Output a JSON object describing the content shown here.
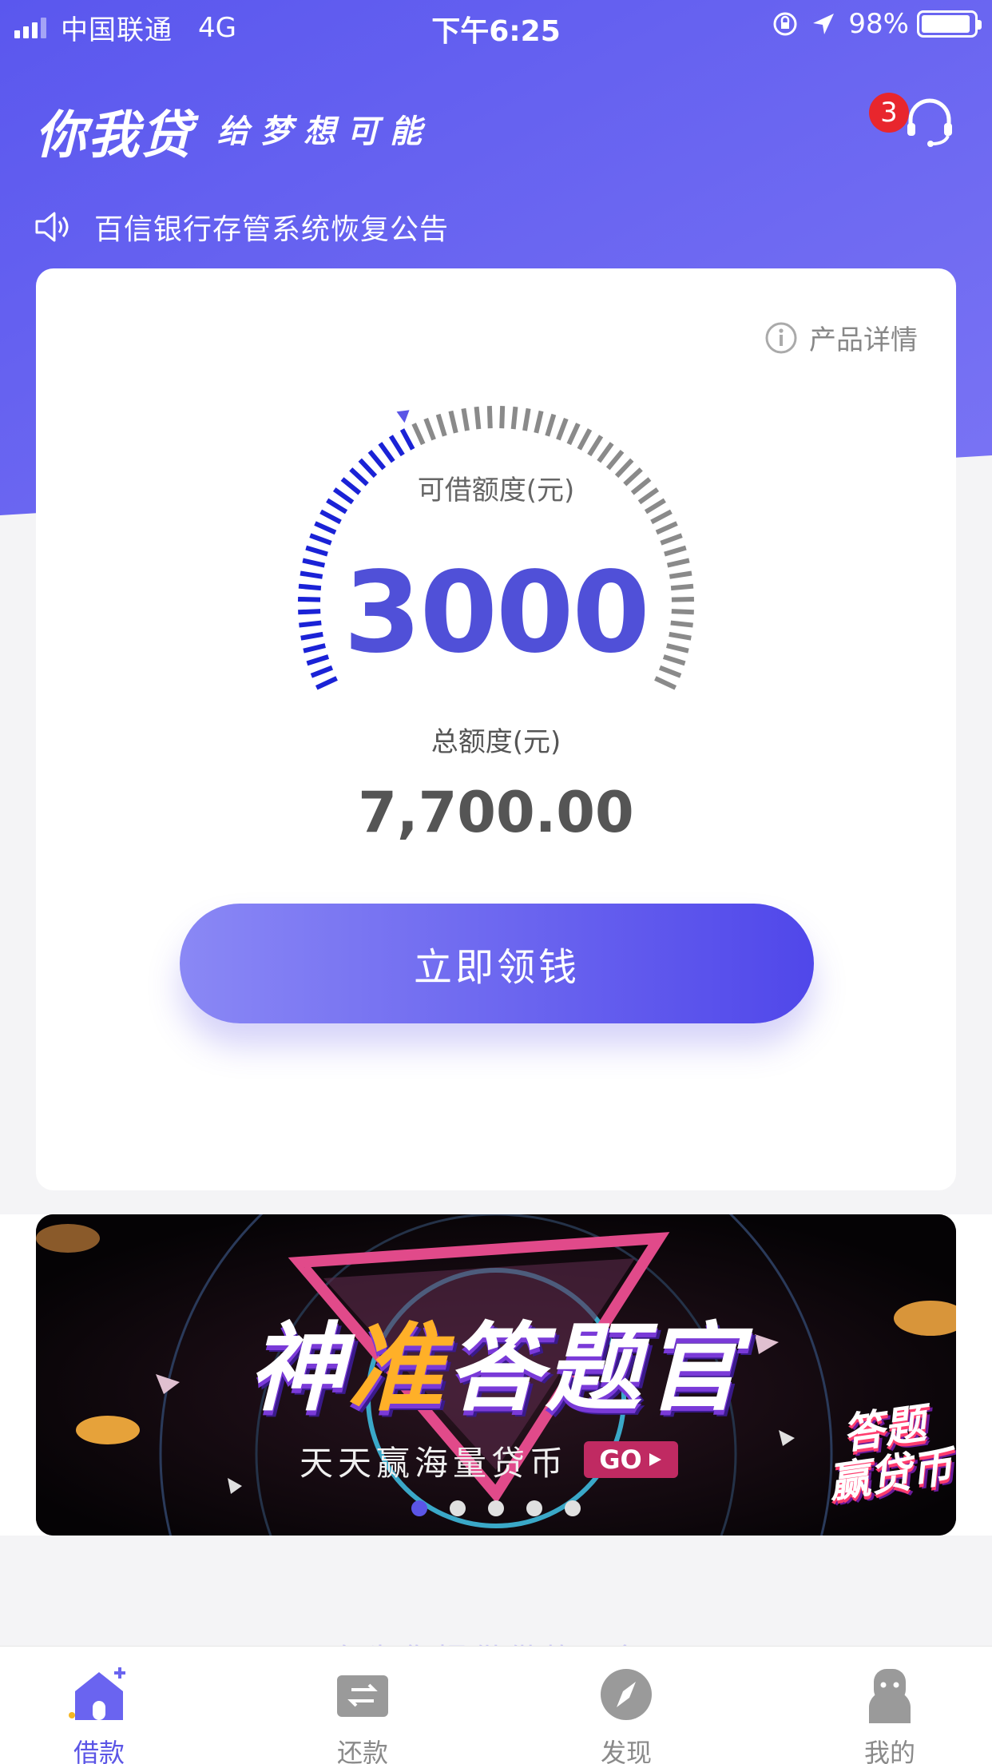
{
  "status_bar": {
    "carrier": "中国联通",
    "network": "4G",
    "time": "下午6:25",
    "battery": "98%"
  },
  "header": {
    "logo": "你我贷",
    "slogan": "给梦想可能",
    "support_badge": "3",
    "icon": "headset-icon"
  },
  "notice": {
    "icon": "speaker-icon",
    "text": "百信银行存管系统恢复公告"
  },
  "card": {
    "detail_link": "产品详情",
    "available_label": "可借额度(元)",
    "available_amount": "3000",
    "total_label": "总额度(元)",
    "total_amount": "7,700.00",
    "cta": "立即领钱",
    "gauge_fraction": 0.39
  },
  "banner": {
    "title_accent": "准",
    "title_a": "神",
    "title_b": "答题官",
    "subtitle": "天天赢海量贷币",
    "go": "GO",
    "corner_badge_line1": "答题",
    "corner_badge_line2": "赢贷币",
    "dot_count": 5,
    "active_dot": 0
  },
  "faded_text": "正在为您提供借款服务",
  "tabs": [
    {
      "label": "借款",
      "icon": "home-icon",
      "active": true
    },
    {
      "label": "还款",
      "icon": "repay-card-icon",
      "active": false
    },
    {
      "label": "发现",
      "icon": "compass-icon",
      "active": false
    },
    {
      "label": "我的",
      "icon": "user-icon",
      "active": false
    }
  ],
  "colors": {
    "primary": "#5b55e6",
    "gauge_active": "#1a22d6",
    "gauge_inactive": "#8a8a8a",
    "badge": "#e8262d"
  }
}
